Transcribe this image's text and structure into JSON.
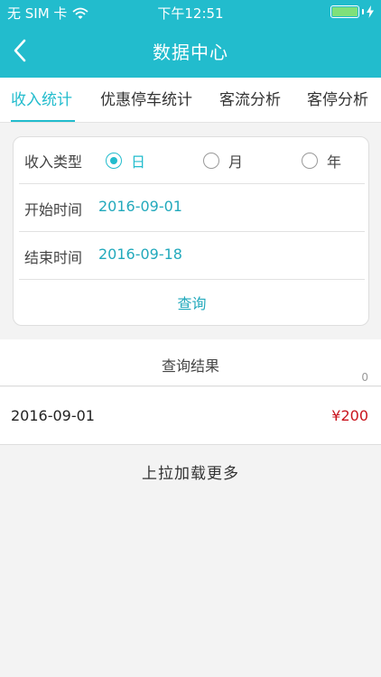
{
  "status_bar": {
    "carrier": "无 SIM 卡",
    "time": "下午12:51"
  },
  "navbar": {
    "title": "数据中心"
  },
  "tabs": [
    {
      "label": "收入统计",
      "active": true
    },
    {
      "label": "优惠停车统计",
      "active": false
    },
    {
      "label": "客流分析",
      "active": false
    },
    {
      "label": "客停分析",
      "active": false
    }
  ],
  "form": {
    "income_type_label": "收入类型",
    "options": [
      {
        "label": "日",
        "checked": true
      },
      {
        "label": "月",
        "checked": false
      },
      {
        "label": "年",
        "checked": false
      }
    ],
    "start_label": "开始时间",
    "start_value": "2016-09-01",
    "end_label": "结束时间",
    "end_value": "2016-09-18",
    "query_label": "查询"
  },
  "results": {
    "title": "查询结果",
    "count": "0",
    "rows": [
      {
        "date": "2016-09-01",
        "amount": "¥200"
      }
    ]
  },
  "load_more": "上拉加载更多",
  "colors": {
    "accent": "#22bccd",
    "amount": "#c9141d"
  }
}
